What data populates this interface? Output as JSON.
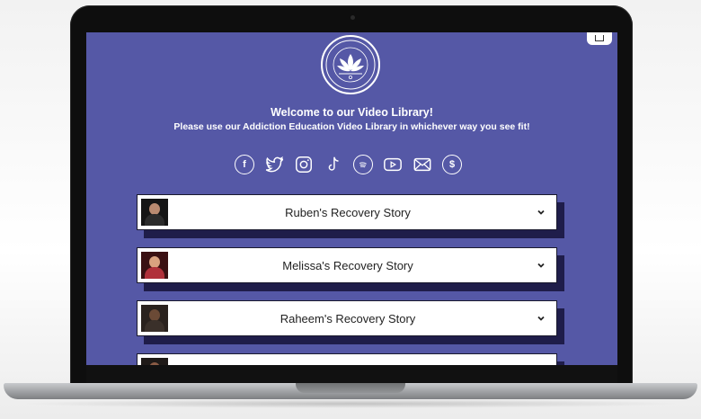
{
  "header": {
    "logo_text": "ALUMNI IN RECOVERY",
    "logo_subtext": "CHOICE • AWARENESS • EDUCATION"
  },
  "intro": {
    "title": "Welcome to our Video Library!",
    "subtitle": "Please use our Addiction Education Video Library in whichever way you see fit!"
  },
  "socials": [
    {
      "name": "facebook",
      "glyph": "f"
    },
    {
      "name": "twitter",
      "glyph": ""
    },
    {
      "name": "instagram",
      "glyph": ""
    },
    {
      "name": "tiktok",
      "glyph": "♪"
    },
    {
      "name": "spotify",
      "glyph": ""
    },
    {
      "name": "youtube",
      "glyph": ""
    },
    {
      "name": "email",
      "glyph": ""
    },
    {
      "name": "donate",
      "glyph": "$"
    }
  ],
  "videos": [
    {
      "title": "Ruben's Recovery Story"
    },
    {
      "title": "Melissa's Recovery Story"
    },
    {
      "title": "Raheem's Recovery Story"
    },
    {
      "title": ""
    }
  ],
  "colors": {
    "page_bg": "#5558a6",
    "card_shadow": "#1f1d4a",
    "card_bg": "#ffffff"
  }
}
